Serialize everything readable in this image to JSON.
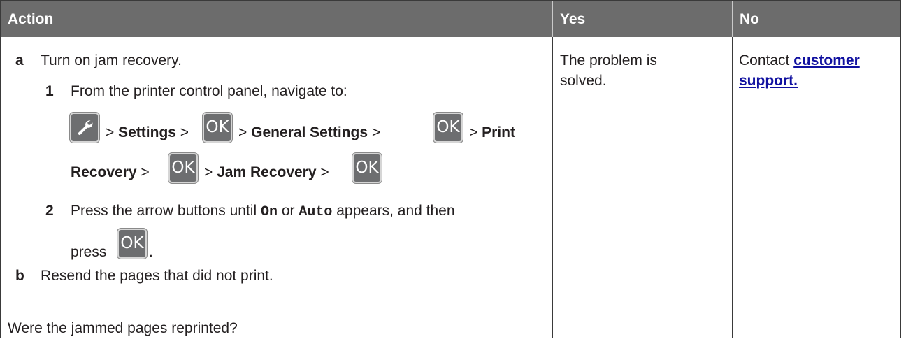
{
  "header": {
    "action": "Action",
    "yes": "Yes",
    "no": "No"
  },
  "action": {
    "step_a": {
      "label": "a",
      "text": "Turn on jam recovery.",
      "sub1": {
        "num": "1",
        "text": "From the printer control panel, navigate to:",
        "path": {
          "sep": ">",
          "settings": "Settings",
          "general_settings": "General Settings",
          "print": "Print",
          "recovery": "Recovery",
          "jam_recovery": "Jam Recovery",
          "ok": "OK"
        }
      },
      "sub2": {
        "num": "2",
        "before": "Press the arrow buttons until",
        "on": "On",
        "or": "or",
        "auto": "Auto",
        "after": "appears, and then",
        "press": "press",
        "ok": "OK",
        "period": "."
      }
    },
    "step_b": {
      "label": "b",
      "text": "Resend the pages that did not print."
    },
    "question": "Were the jammed pages reprinted?"
  },
  "yes": {
    "line1": "The problem is",
    "line2": "solved."
  },
  "no": {
    "prefix": "Contact",
    "link1": "customer",
    "link2": "support."
  },
  "icons": {
    "settings_button": "wrench-icon",
    "ok_button": "ok-button"
  },
  "colors": {
    "header_bg": "#6c6c6c",
    "button_bg": "#6d6e70",
    "link": "#1010a0"
  }
}
